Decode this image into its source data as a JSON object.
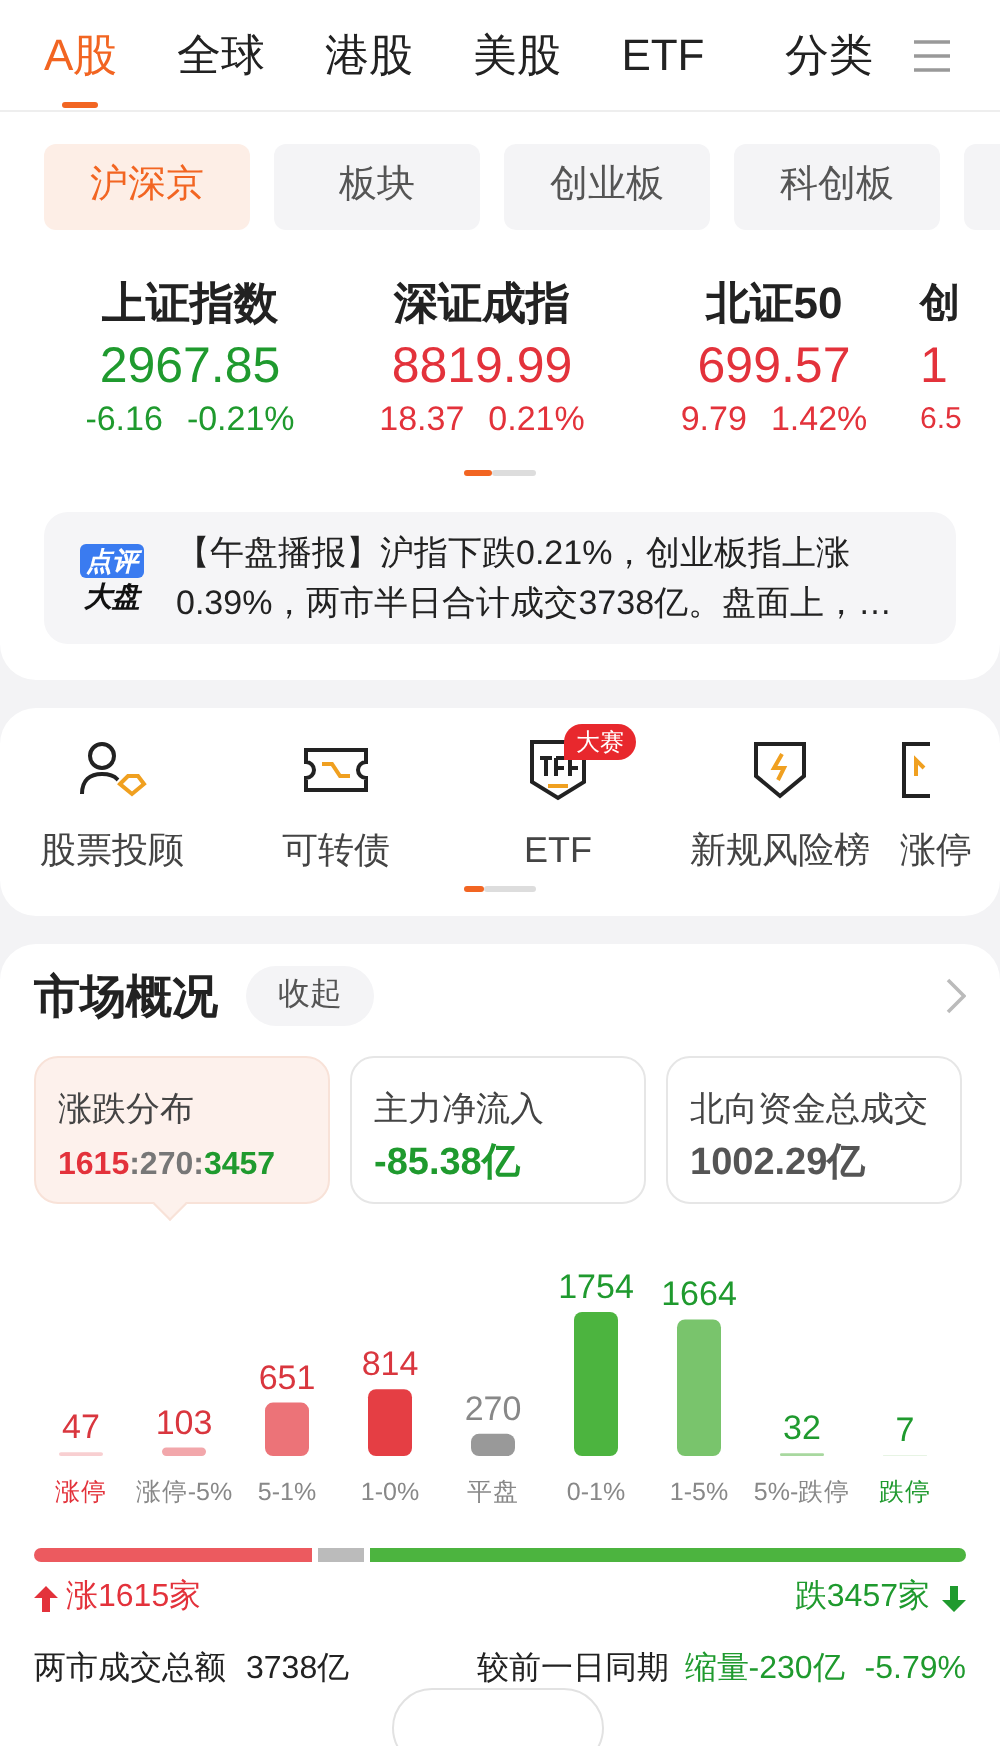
{
  "tabs": [
    {
      "label": "A股",
      "selected": true
    },
    {
      "label": "全球",
      "selected": false
    },
    {
      "label": "港股",
      "selected": false
    },
    {
      "label": "美股",
      "selected": false
    },
    {
      "label": "ETF",
      "selected": false
    },
    {
      "label": "分类",
      "selected": false
    }
  ],
  "chips": [
    {
      "label": "沪深京",
      "selected": true
    },
    {
      "label": "板块",
      "selected": false
    },
    {
      "label": "创业板",
      "selected": false
    },
    {
      "label": "科创板",
      "selected": false
    }
  ],
  "indices": [
    {
      "name": "上证指数",
      "value": "2967.85",
      "change": "-6.16",
      "percent": "-0.21%",
      "color": "#1f9a2e"
    },
    {
      "name": "深证成指",
      "value": "8819.99",
      "change": "18.37",
      "percent": "0.21%",
      "color": "#e3323b"
    },
    {
      "name": "北证50",
      "value": "699.57",
      "change": "9.79",
      "percent": "1.42%",
      "color": "#e3323b"
    },
    {
      "name": "创",
      "value": "1",
      "change": "6.5",
      "color": "#e3323b"
    }
  ],
  "news": {
    "badge_top": "点评",
    "badge_bottom": "大盘",
    "text": "【午盘播报】沪指下跌0.21%，创业板指上涨0.39%，两市半日合计成交3738亿。盘面上，…"
  },
  "shortcuts": [
    {
      "label": "股票投顾"
    },
    {
      "label": "可转债"
    },
    {
      "label": "ETF",
      "badge": "大赛"
    },
    {
      "label": "新规风险榜"
    },
    {
      "label": "涨停"
    }
  ],
  "market": {
    "title": "市场概况",
    "collapse": "收起",
    "cards": [
      {
        "label": "涨跌分布",
        "selected": true,
        "value_parts": [
          {
            "text": "1615",
            "color": "#e3323b"
          },
          {
            "text": ":270:",
            "color": "#777777"
          },
          {
            "text": "3457",
            "color": "#1f9a2e"
          }
        ]
      },
      {
        "label": "主力净流入",
        "selected": false,
        "value_parts": [
          {
            "text": "-85.38亿",
            "color": "#1f9a2e"
          }
        ]
      },
      {
        "label": "北向资金总成交",
        "selected": false,
        "value_parts": [
          {
            "text": "1002.29亿",
            "color": "#555555"
          }
        ]
      }
    ],
    "chart_data": {
      "type": "bar",
      "categories": [
        "涨停",
        "涨停-5%",
        "5-1%",
        "1-0%",
        "平盘",
        "0-1%",
        "1-5%",
        "5%-跌停",
        "跌停"
      ],
      "values": [
        47,
        103,
        651,
        814,
        270,
        1754,
        1664,
        32,
        7
      ],
      "data_labels": true
    },
    "up_label": "涨1615家",
    "down_label": "跌3457家",
    "turnover_label": "两市成交总额",
    "turnover_value": "3738亿",
    "compare_label": "较前一日同期",
    "compare_change": "缩量-230亿",
    "compare_percent": "-5.79%"
  }
}
